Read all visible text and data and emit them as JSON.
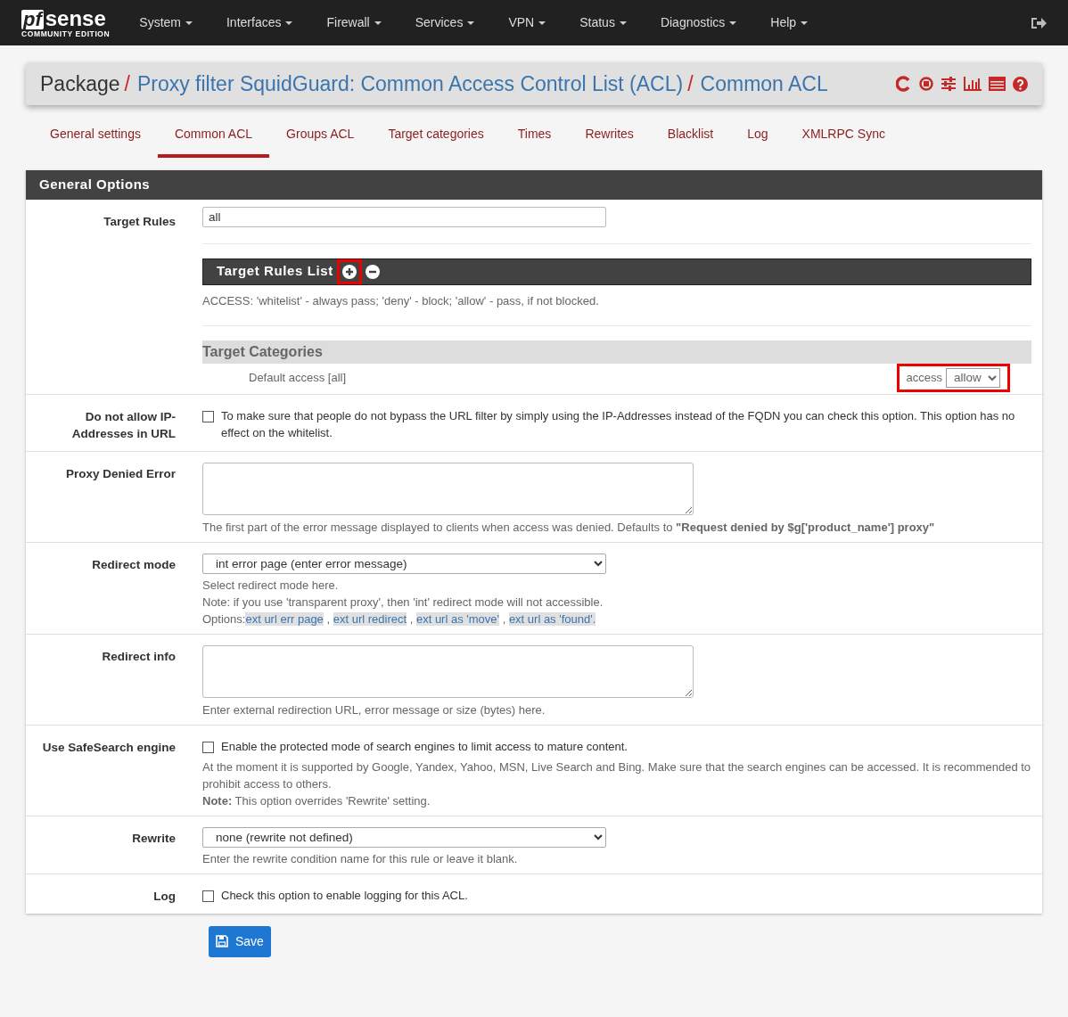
{
  "navbar": {
    "logo_box": "pf",
    "logo_word": "sense",
    "edition": "COMMUNITY EDITION",
    "menus": [
      "System",
      "Interfaces",
      "Firewall",
      "Services",
      "VPN",
      "Status",
      "Diagnostics",
      "Help"
    ]
  },
  "breadcrumb": {
    "root": "Package",
    "separators": [
      "/",
      "/"
    ],
    "parts": [
      "Proxy filter SquidGuard: Common Access Control List (ACL)",
      "Common ACL"
    ]
  },
  "tabs": [
    {
      "label": "General settings",
      "selected": false
    },
    {
      "label": "Common ACL",
      "selected": true
    },
    {
      "label": "Groups ACL",
      "selected": false
    },
    {
      "label": "Target categories",
      "selected": false
    },
    {
      "label": "Times",
      "selected": false
    },
    {
      "label": "Rewrites",
      "selected": false
    },
    {
      "label": "Blacklist",
      "selected": false
    },
    {
      "label": "Log",
      "selected": false
    },
    {
      "label": "XMLRPC Sync",
      "selected": false
    }
  ],
  "panel": {
    "title": "General Options"
  },
  "rows": [
    {
      "kind": "target_rules",
      "label": "Target Rules",
      "value": "all",
      "list_title": "Target Rules List",
      "add_highlighted": true,
      "access_help": "ACCESS: 'whitelist' - always pass; 'deny' - block; 'allow' - pass, if not blocked.",
      "categories_title": "Target Categories",
      "default_label": "Default access [all]",
      "access_label": "access",
      "access_value": "allow",
      "access_highlighted": true
    },
    {
      "kind": "checkbox",
      "label": "Do not allow IP-Addresses in URL",
      "checked": false,
      "text": "To make sure that people do not bypass the URL filter by simply using the IP-Addresses instead of the FQDN you can check this option. This option has no effect on the whitelist."
    },
    {
      "kind": "textarea",
      "label": "Proxy Denied Error",
      "help": [
        "The first part of the error message displayed to clients when access was denied. Defaults to **\"Request denied by $g['product_name'] proxy\"**"
      ]
    },
    {
      "kind": "select",
      "label": "Redirect mode",
      "value": "int error page (enter error message)",
      "help": [
        "Select redirect mode here.",
        "Note: if you use 'transparent proxy', then 'int' redirect mode will not accessible."
      ],
      "options_line": [
        {
          "text": "Options:",
          "link": false
        },
        {
          "text": "ext url err page",
          "link": true
        },
        {
          "text": " , ",
          "link": false
        },
        {
          "text": "ext url redirect",
          "link": true
        },
        {
          "text": " , ",
          "link": false
        },
        {
          "text": "ext url as 'move'",
          "link": true
        },
        {
          "text": " , ",
          "link": false
        },
        {
          "text": "ext url as 'found'.",
          "link": true
        }
      ]
    },
    {
      "kind": "textarea",
      "label": "Redirect info",
      "help": [
        "Enter external redirection URL, error message or size (bytes) here."
      ]
    },
    {
      "kind": "checkbox",
      "label": "Use SafeSearch engine",
      "checked": false,
      "text": "Enable the protected mode of search engines to limit access to mature content.",
      "help": [
        "At the moment it is supported by Google, Yandex, Yahoo, MSN, Live Search and Bing. Make sure that the search engines can be accessed. It is recommended to prohibit access to others.",
        "**Note:** This option overrides 'Rewrite' setting."
      ]
    },
    {
      "kind": "select",
      "label": "Rewrite",
      "value": "none (rewrite not defined)",
      "help": [
        "Enter the rewrite condition name for this rule or leave it blank."
      ]
    },
    {
      "kind": "checkbox",
      "label": "Log",
      "checked": false,
      "text": "Check this option to enable logging for this ACL."
    }
  ],
  "save_button": "Save"
}
